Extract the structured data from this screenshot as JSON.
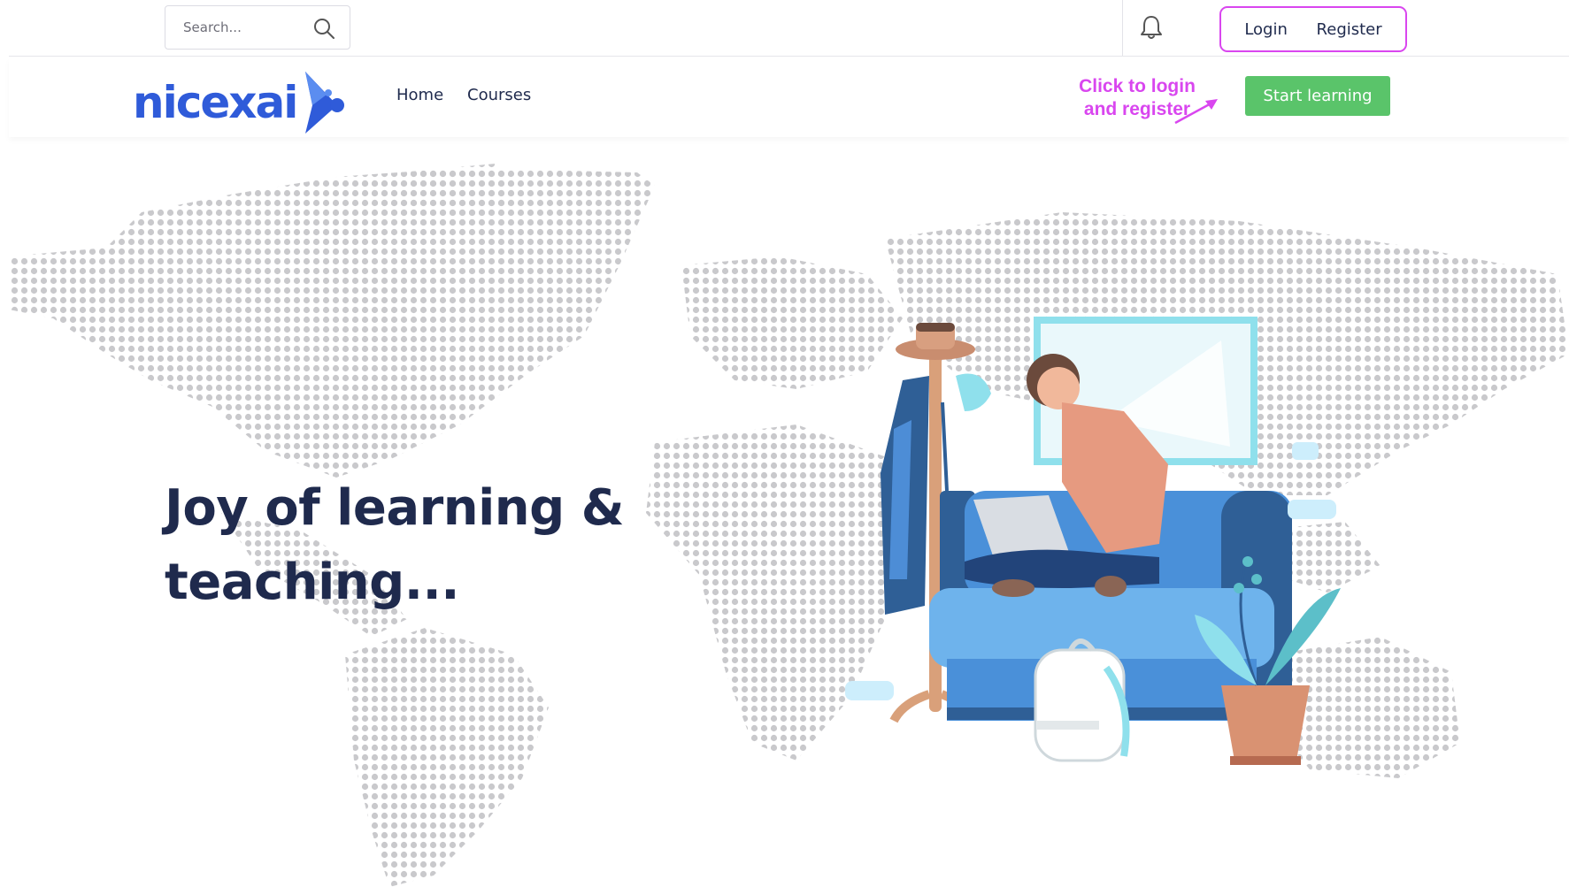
{
  "topbar": {
    "search_placeholder": "Search...",
    "login_label": "Login",
    "register_label": "Register"
  },
  "navbar": {
    "logo_text": "nicexai",
    "links": [
      {
        "label": "Home"
      },
      {
        "label": "Courses"
      }
    ],
    "annotation_line1": "Click to login",
    "annotation_line2": "and register",
    "cta_label": "Start learning"
  },
  "hero": {
    "title_line1": "Joy of learning &",
    "title_line2": "teaching..."
  },
  "icons": {
    "search": "search-icon",
    "notifications": "bell-icon",
    "logo": "nicexai-logo-mark"
  },
  "colors": {
    "brand_blue": "#2f5bd9",
    "cta_green": "#5ac46a",
    "annotation_magenta": "#d946ef",
    "heading_navy": "#1f2a4d"
  }
}
